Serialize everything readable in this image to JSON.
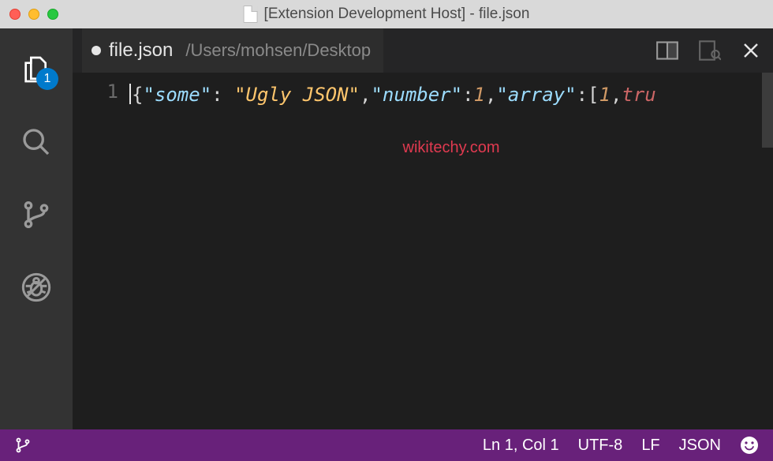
{
  "titlebar": {
    "title": "[Extension Development Host] - file.json"
  },
  "activity": {
    "badge": "1"
  },
  "tab": {
    "name": "file.json",
    "path": "/Users/mohsen/Desktop"
  },
  "editor": {
    "line_number": "1",
    "code": {
      "b0": "{",
      "k0": "\"some\"",
      "p0": ": ",
      "s0": "\"Ugly JSON\"",
      "p1": ",",
      "k1": "\"number\"",
      "p2": ":",
      "n0": "1",
      "p3": ",",
      "k2": "\"array\"",
      "p4": ":[",
      "n1": "1",
      "p5": ",",
      "b1": "tru"
    }
  },
  "watermark": "wikitechy.com",
  "status": {
    "pos": "Ln 1, Col 1",
    "encoding": "UTF-8",
    "eol": "LF",
    "lang": "JSON"
  }
}
